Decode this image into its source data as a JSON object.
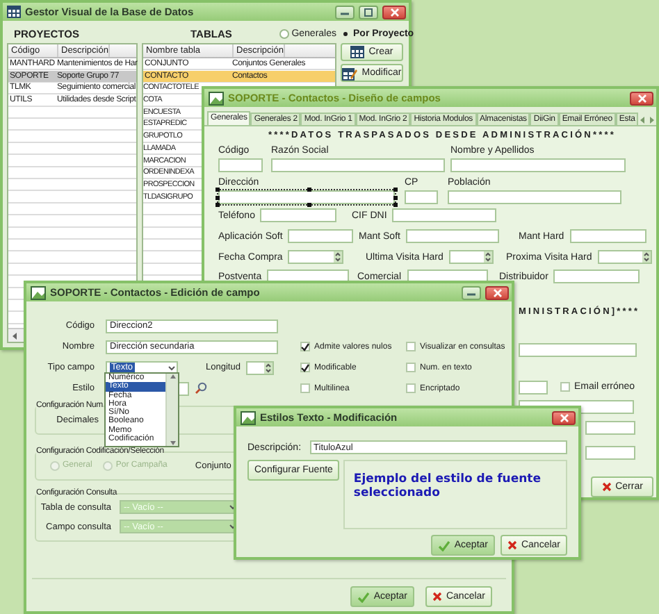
{
  "main_window": {
    "title": "Gestor Visual de la Base de Datos",
    "projects": {
      "heading": "PROYECTOS",
      "columns": [
        "Código",
        "Descripción"
      ],
      "rows": [
        {
          "cells": [
            "MANTHARD",
            "Mantenimientos de Har"
          ],
          "selected": false
        },
        {
          "cells": [
            "SOPORTE",
            "Soporte Grupo 77"
          ],
          "selected": true
        },
        {
          "cells": [
            "TLMK",
            "Seguimiento comercial"
          ],
          "selected": false
        },
        {
          "cells": [
            "UTILS",
            "Utilidades desde Script"
          ],
          "selected": false
        }
      ]
    },
    "tables": {
      "heading": "TABLAS",
      "scope": [
        {
          "label": "Generales",
          "selected": false
        },
        {
          "label": "Por Proyecto",
          "selected": true
        }
      ],
      "columns": [
        "Nombre tabla",
        "Descripción"
      ],
      "rows": [
        {
          "cells": [
            "CONJUNTO",
            "Conjuntos Generales"
          ],
          "selected": false
        },
        {
          "cells": [
            "CONTACTO",
            "Contactos"
          ],
          "selected": true
        },
        {
          "cells": [
            "CONTACTOTELE"
          ],
          "selected": false
        },
        {
          "cells": [
            "COTA"
          ],
          "selected": false
        },
        {
          "cells": [
            "ENCUESTA"
          ],
          "selected": false
        },
        {
          "cells": [
            "ESTAPREDIC"
          ],
          "selected": false
        },
        {
          "cells": [
            "GRUPOTLO"
          ],
          "selected": false
        },
        {
          "cells": [
            "LLAMADA"
          ],
          "selected": false
        },
        {
          "cells": [
            "MARCACION"
          ],
          "selected": false
        },
        {
          "cells": [
            "ORDENINDEXA"
          ],
          "selected": false
        },
        {
          "cells": [
            "PROSPECCION"
          ],
          "selected": false
        },
        {
          "cells": [
            "TLDASIGRUPO"
          ],
          "selected": false
        }
      ]
    },
    "buttons": [
      {
        "kind": "create",
        "label": "Crear"
      },
      {
        "kind": "modify",
        "label": "Modificar"
      }
    ]
  },
  "design_window": {
    "title": "SOPORTE - Contactos - Diseño de campos",
    "tabs": [
      {
        "label": "Generales",
        "selected": true
      },
      {
        "label": "Generales 2",
        "selected": false
      },
      {
        "label": "Mod. InGrio 1",
        "selected": false
      },
      {
        "label": "Mod. InGrio 2",
        "selected": false
      },
      {
        "label": "Historia Modulos",
        "selected": false
      },
      {
        "label": "Almacenistas",
        "selected": false
      },
      {
        "label": "DiiGin",
        "selected": false
      },
      {
        "label": "Email Erróneo",
        "selected": false
      },
      {
        "label": "Esta",
        "selected": false
      }
    ],
    "heading": "****DATOS TRASPASADOS DESDE ADMINISTRACIÓN****",
    "fields": [
      {
        "label": "Código",
        "kind": "text",
        "selected": false
      },
      {
        "label": "Razón Social",
        "kind": "text",
        "selected": false
      },
      {
        "label": "Nombre y Apellidos",
        "kind": "text",
        "selected": false
      },
      {
        "label": "Dirección",
        "kind": "text",
        "selected": true
      },
      {
        "label": "CP",
        "kind": "text",
        "selected": false
      },
      {
        "label": "Población",
        "kind": "text",
        "selected": false
      },
      {
        "label": "Teléfono",
        "kind": "text",
        "selected": false
      },
      {
        "label": "CIF DNI",
        "kind": "text",
        "selected": false
      },
      {
        "label": "Aplicación Soft",
        "kind": "text",
        "selected": false
      },
      {
        "label": "Mant Soft",
        "kind": "text",
        "selected": false
      },
      {
        "label": "Mant Hard",
        "kind": "text",
        "selected": false
      },
      {
        "label": "Fecha Compra",
        "kind": "date",
        "selected": false
      },
      {
        "label": "Ultima Visita Hard",
        "kind": "date",
        "selected": false
      },
      {
        "label": "Proxima Visita Hard",
        "kind": "date",
        "selected": false
      },
      {
        "label": "Postventa",
        "kind": "text",
        "selected": false
      },
      {
        "label": "Comercial",
        "kind": "text",
        "selected": false
      },
      {
        "label": "Distribuidor",
        "kind": "text",
        "selected": false
      }
    ],
    "heading_2": "MINISTRACIÓN]****",
    "email_check": {
      "label": "Email erróneo",
      "checked": false
    },
    "close_button": {
      "kind": "cancel",
      "label": "Cerrar"
    }
  },
  "edit_window": {
    "title": "SOPORTE - Contactos - Edición de campo",
    "code": {
      "label": "Código",
      "value": "Direccion2"
    },
    "name": {
      "label": "Nombre",
      "value": "Dirección secundaria"
    },
    "field_type": {
      "label": "Tipo campo",
      "value": "Texto",
      "options": [
        {
          "label": "Numérico",
          "selected": false
        },
        {
          "label": "Texto",
          "selected": true
        },
        {
          "label": "Fecha",
          "selected": false
        },
        {
          "label": "Hora",
          "selected": false
        },
        {
          "label": "Sí/No",
          "selected": false
        },
        {
          "label": "Booleano",
          "selected": false
        },
        {
          "label": "Memo",
          "selected": false
        },
        {
          "label": "Codificación",
          "selected": false
        }
      ]
    },
    "length": {
      "label": "Longitud"
    },
    "style": {
      "label": "Estilo"
    },
    "options": [
      {
        "label": "Admite valores nulos",
        "checked": true
      },
      {
        "label": "Visualizar en consultas",
        "checked": false
      },
      {
        "label": "Modificable",
        "checked": true
      },
      {
        "label": "Num. en texto",
        "checked": false
      },
      {
        "label": "Multilinea",
        "checked": false
      },
      {
        "label": "Encriptado",
        "checked": false
      }
    ],
    "numeric_group": {
      "title": "Configuración Num",
      "decimals_label": "Decimales"
    },
    "coding_group": {
      "title": "Configuración Codificación/Selección",
      "modes": [
        {
          "label": "General",
          "selected": false,
          "disabled": true
        },
        {
          "label": "Por Campaña",
          "selected": false,
          "disabled": true
        }
      ],
      "set_label": "Conjunto"
    },
    "query_group": {
      "title": "Configuración Consulta",
      "fields": [
        {
          "label": "Tabla de consulta",
          "value": "-- Vacío --",
          "disabled": true
        },
        {
          "label": "Campo consulta",
          "value": "-- Vacío --",
          "disabled": true
        }
      ]
    },
    "buttons": [
      {
        "kind": "accept",
        "label": "Aceptar"
      },
      {
        "kind": "cancel",
        "label": "Cancelar"
      }
    ]
  },
  "style_window": {
    "title": "Estilos Texto - Modificación",
    "description": {
      "label": "Descripción:",
      "value": "TituloAzul"
    },
    "font_button": "Configurar Fuente",
    "preview": "Ejemplo del estilo de fuente seleccionado",
    "buttons": [
      {
        "kind": "accept",
        "label": "Aceptar"
      },
      {
        "kind": "cancel",
        "label": "Cancelar"
      }
    ]
  }
}
